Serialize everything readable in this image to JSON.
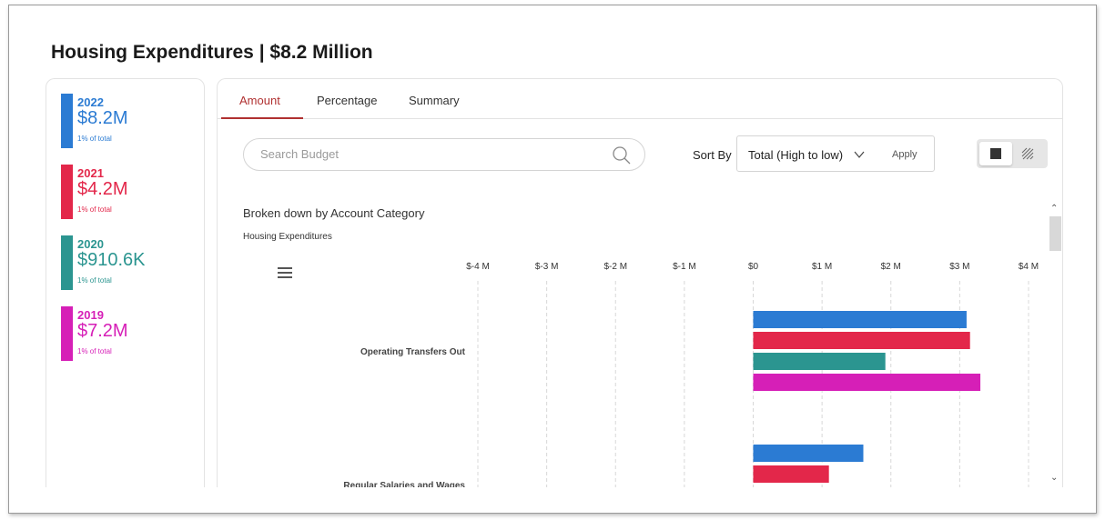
{
  "page": {
    "title": "Housing Expenditures | $8.2 Million"
  },
  "years": [
    {
      "year": "2022",
      "amount": "$8.2M",
      "pct": "1% of total",
      "color": "#2b7bd3"
    },
    {
      "year": "2021",
      "amount": "$4.2M",
      "pct": "1% of total",
      "color": "#e3274a"
    },
    {
      "year": "2020",
      "amount": "$910.6K",
      "pct": "1% of total",
      "color": "#2b9590"
    },
    {
      "year": "2019",
      "amount": "$7.2M",
      "pct": "1% of total",
      "color": "#d61fb7"
    }
  ],
  "tabs": [
    {
      "label": "Amount",
      "active": true
    },
    {
      "label": "Percentage",
      "active": false
    },
    {
      "label": "Summary",
      "active": false
    }
  ],
  "search": {
    "placeholder": "Search Budget",
    "value": ""
  },
  "sort": {
    "label": "Sort By",
    "value": "Total (High to low)",
    "apply_label": "Apply"
  },
  "icons": {
    "search": "search-icon",
    "chevron": "chevron-down-icon",
    "menu": "menu-icon",
    "solid_view": "solid-fill-icon",
    "hatch_view": "hatch-fill-icon",
    "scroll_up": "chevron-up-icon",
    "scroll_down": "chevron-down-icon"
  },
  "chart_data": {
    "type": "bar",
    "orientation": "horizontal",
    "title": "Broken down by Account Category",
    "subtitle": "Housing Expenditures",
    "x_ticks": [
      "$-4 M",
      "$-3 M",
      "$-2 M",
      "$-1 M",
      "$0",
      "$1 M",
      "$2 M",
      "$3 M",
      "$4 M"
    ],
    "xlim": [
      -4000000,
      4000000
    ],
    "grid": true,
    "categories": [
      "Operating Transfers Out",
      "Regular Salaries and Wages"
    ],
    "series": [
      {
        "name": "2022",
        "color": "#2b7bd3",
        "values": [
          3100000,
          1600000
        ]
      },
      {
        "name": "2021",
        "color": "#e3274a",
        "values": [
          3150000,
          1100000
        ]
      },
      {
        "name": "2020",
        "color": "#2b9590",
        "values": [
          1920000,
          null
        ]
      },
      {
        "name": "2019",
        "color": "#d61fb7",
        "values": [
          3300000,
          null
        ]
      }
    ]
  }
}
